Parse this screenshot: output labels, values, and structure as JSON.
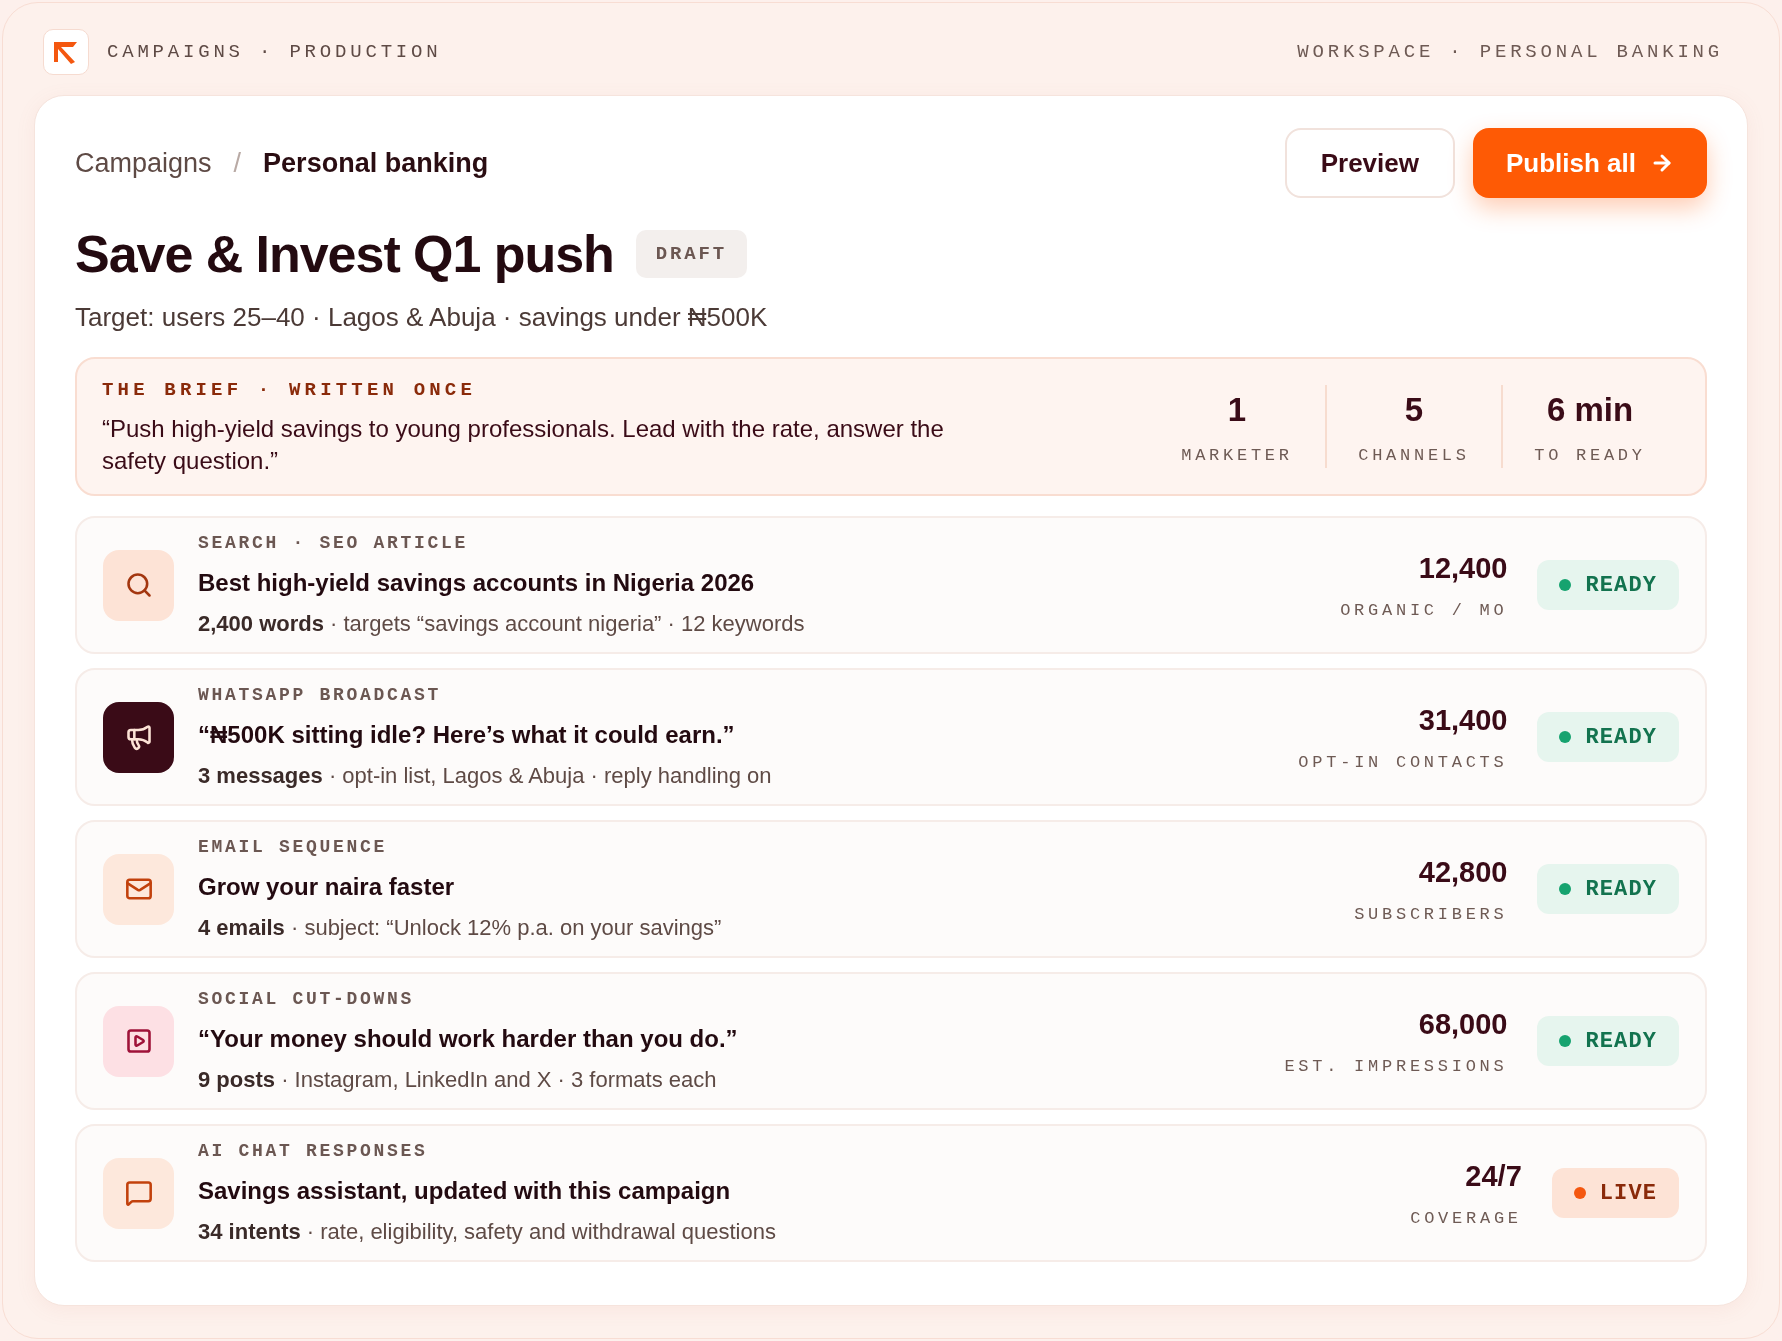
{
  "top_bar": {
    "left": "CAMPAIGNS · PRODUCTION",
    "right": "WORKSPACE · PERSONAL BANKING"
  },
  "breadcrumb": {
    "parent": "Campaigns",
    "separator": "/",
    "current": "Personal banking"
  },
  "actions": [
    {
      "label": "Preview",
      "kind": "secondary"
    },
    {
      "label": "Publish all",
      "kind": "primary"
    }
  ],
  "title": "Save & Invest Q1 push",
  "status_tag": "DRAFT",
  "subtitle": "Target: users 25–40 · Lagos & Abuja · savings under ₦500K",
  "brief": {
    "label": "THE BRIEF · WRITTEN ONCE",
    "text": "“Push high-yield savings to young professionals. Lead with the rate, answer the safety question.”",
    "stats": [
      {
        "value": "1",
        "label": "MARKETER"
      },
      {
        "value": "5",
        "label": "CHANNELS"
      },
      {
        "value": "6 min",
        "label": "TO READY"
      }
    ]
  },
  "channels": [
    {
      "category": "SEARCH · SEO ARTICLE",
      "title": "Best high-yield savings accounts in Nigeria 2026",
      "meta": "**2,400 words** · targets “savings account nigeria” · 12 keywords",
      "metric": "12,400",
      "metric_label": "ORGANIC / MO",
      "status": {
        "label": "READY",
        "kind": "ready"
      }
    },
    {
      "category": "WHATSAPP BROADCAST",
      "title": "“₦500K sitting idle? Here’s what it could earn.”",
      "meta": "**3 messages** · opt-in list, Lagos & Abuja · reply handling on",
      "metric": "31,400",
      "metric_label": "OPT-IN CONTACTS",
      "status": {
        "label": "READY",
        "kind": "ready"
      }
    },
    {
      "category": "EMAIL SEQUENCE",
      "title": "Grow your naira faster",
      "meta": "**4 emails** · subject: “Unlock 12% p.a. on your savings”",
      "metric": "42,800",
      "metric_label": "SUBSCRIBERS",
      "status": {
        "label": "READY",
        "kind": "ready"
      }
    },
    {
      "category": "SOCIAL CUT-DOWNS",
      "title": "“Your money should work harder than you do.”",
      "meta": "**9 posts** · Instagram, LinkedIn and X · 3 formats each",
      "metric": "68,000",
      "metric_label": "EST. IMPRESSIONS",
      "status": {
        "label": "READY",
        "kind": "ready"
      }
    },
    {
      "category": "AI CHAT RESPONSES",
      "title": "Savings assistant, updated with this campaign",
      "meta": "**34 intents** · rate, eligibility, safety and withdrawal questions",
      "metric": "24/7",
      "metric_label": "COVERAGE",
      "status": {
        "label": "LIVE",
        "kind": "live"
      }
    }
  ]
}
